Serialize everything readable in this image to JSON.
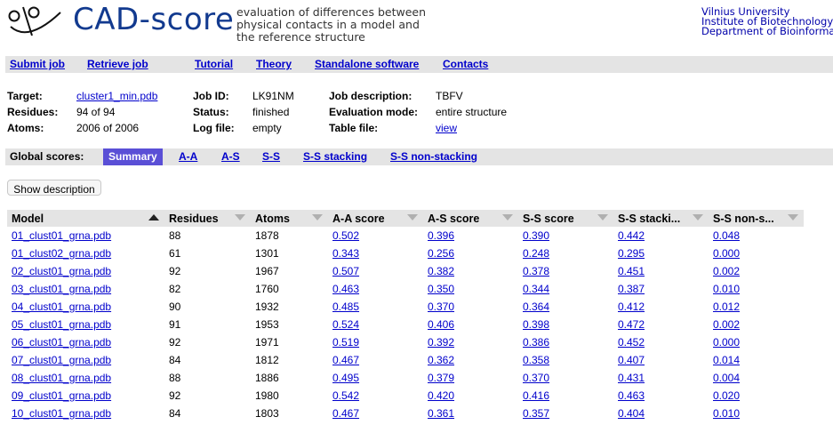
{
  "brand": {
    "name": "CAD-score",
    "tagline": "evaluation of differences between physical contacts in a model and the reference structure"
  },
  "university": [
    "Vilnius University",
    "Institute of Biotechnology",
    "Department of Bioinformat"
  ],
  "nav": [
    "Submit job",
    "Retrieve job",
    "Tutorial",
    "Theory",
    "Standalone software",
    "Contacts"
  ],
  "job": {
    "target_label": "Target:",
    "target": "cluster1_min.pdb",
    "residues_label": "Residues:",
    "residues": "94 of 94",
    "atoms_label": "Atoms:",
    "atoms": "2006 of 2006",
    "jobid_label": "Job ID:",
    "jobid": "LK91NM",
    "status_label": "Status:",
    "status": "finished",
    "logfile_label": "Log file:",
    "logfile": "empty",
    "desc_label": "Job description:",
    "desc": "TBFV",
    "mode_label": "Evaluation mode:",
    "mode": "entire structure",
    "table_label": "Table file:",
    "table": "view"
  },
  "scores_bar": {
    "title": "Global scores:",
    "tabs": [
      "Summary",
      "A-A",
      "A-S",
      "S-S",
      "S-S stacking",
      "S-S non-stacking"
    ],
    "active": 0
  },
  "show_description": "Show description",
  "table": {
    "columns": [
      "Model",
      "Residues",
      "Atoms",
      "A-A score",
      "A-S score",
      "S-S score",
      "S-S stacki...",
      "S-S non-s..."
    ],
    "rows": [
      [
        "01_clust01_grna.pdb",
        "88",
        "1878",
        "0.502",
        "0.396",
        "0.390",
        "0.442",
        "0.048"
      ],
      [
        "01_clust02_grna.pdb",
        "61",
        "1301",
        "0.343",
        "0.256",
        "0.248",
        "0.295",
        "0.000"
      ],
      [
        "02_clust01_grna.pdb",
        "92",
        "1967",
        "0.507",
        "0.382",
        "0.378",
        "0.451",
        "0.002"
      ],
      [
        "03_clust01_grna.pdb",
        "82",
        "1760",
        "0.463",
        "0.350",
        "0.344",
        "0.387",
        "0.010"
      ],
      [
        "04_clust01_grna.pdb",
        "90",
        "1932",
        "0.485",
        "0.370",
        "0.364",
        "0.412",
        "0.012"
      ],
      [
        "05_clust01_grna.pdb",
        "91",
        "1953",
        "0.524",
        "0.406",
        "0.398",
        "0.472",
        "0.002"
      ],
      [
        "06_clust01_grna.pdb",
        "92",
        "1971",
        "0.519",
        "0.392",
        "0.386",
        "0.452",
        "0.000"
      ],
      [
        "07_clust01_grna.pdb",
        "84",
        "1812",
        "0.467",
        "0.362",
        "0.358",
        "0.407",
        "0.014"
      ],
      [
        "08_clust01_grna.pdb",
        "88",
        "1886",
        "0.495",
        "0.379",
        "0.370",
        "0.431",
        "0.004"
      ],
      [
        "09_clust01_grna.pdb",
        "92",
        "1980",
        "0.542",
        "0.420",
        "0.416",
        "0.463",
        "0.020"
      ],
      [
        "10_clust01_grna.pdb",
        "84",
        "1803",
        "0.467",
        "0.361",
        "0.357",
        "0.404",
        "0.010"
      ]
    ]
  }
}
